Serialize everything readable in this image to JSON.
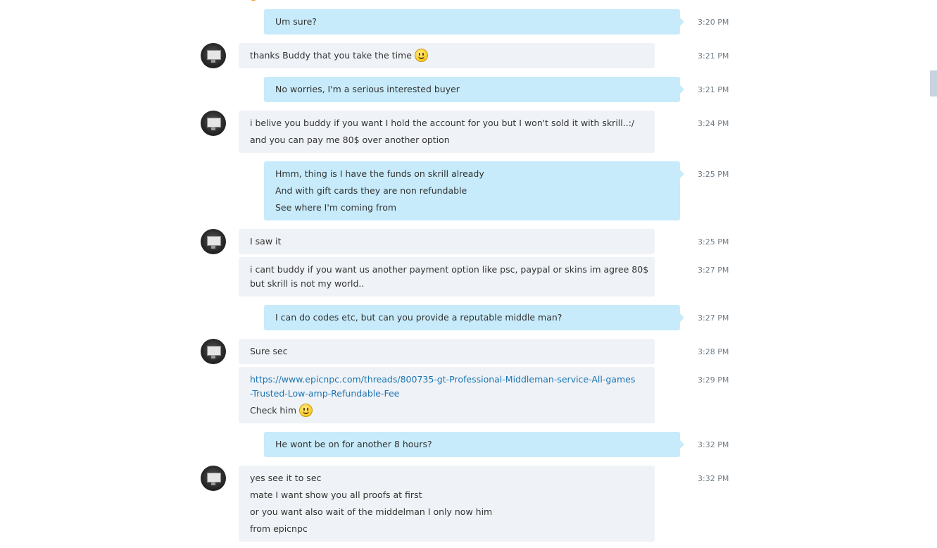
{
  "messages": [
    {
      "from": "me",
      "time": "3:20 PM",
      "lines": [
        "Um sure?"
      ]
    },
    {
      "from": "buddy",
      "time": "3:21 PM",
      "lines": [
        "thanks Buddy that you take the time"
      ],
      "emoji_after_last_line": "smile-emoji"
    },
    {
      "from": "me",
      "time": "3:21 PM",
      "lines": [
        "No worries, I'm a serious interested buyer"
      ]
    },
    {
      "from": "buddy",
      "time": "3:24 PM",
      "lines": [
        "i belive you buddy if you want I hold the account for you but I won't sold it with skrill..:/",
        "and you can pay me 80$ over another option"
      ]
    },
    {
      "from": "me",
      "time": "3:25 PM",
      "lines": [
        "Hmm, thing is I have the funds on skrill already",
        "And with gift cards they are non refundable",
        "See where I'm coming from"
      ]
    },
    {
      "from": "buddy",
      "time": "3:25 PM",
      "lines": [
        "I saw it"
      ]
    },
    {
      "from": "buddy",
      "time": "3:27 PM",
      "lines": [
        "i cant buddy if you want us another payment option like psc, paypal or skins im agree 80$",
        "but skrill is not my world.."
      ]
    },
    {
      "from": "me",
      "time": "3:27 PM",
      "lines": [
        "I can do codes etc, but can you provide a reputable middle man?"
      ]
    },
    {
      "from": "buddy",
      "time": "3:28 PM",
      "lines": [
        "Sure sec"
      ]
    },
    {
      "from": "buddy",
      "time": "3:29 PM",
      "link_lines": [
        "https://www.epicnpc.com/threads/800735-gt-Professional-Middleman-service-All-games",
        "-Trusted-Low-amp-Refundable-Fee"
      ],
      "lines": [
        "Check him"
      ],
      "emoji_after_last_line": "smile-emoji"
    },
    {
      "from": "me",
      "time": "3:32 PM",
      "lines": [
        "He wont be on for another 8 hours?"
      ]
    },
    {
      "from": "buddy",
      "time": "3:32 PM",
      "lines": [
        "yes see it to sec",
        "mate I want show you all proofs at first",
        "or you want also wait of the middelman I only now him",
        "from epicnpc"
      ]
    }
  ],
  "colors": {
    "incoming_bubble": "#eff2f6",
    "outgoing_bubble": "#c7ebfa",
    "link": "#1a75b3",
    "timestamp": "#6f7b85"
  },
  "icons": {
    "avatar": "contact-avatar-icon",
    "emoji": "smile-emoji"
  }
}
